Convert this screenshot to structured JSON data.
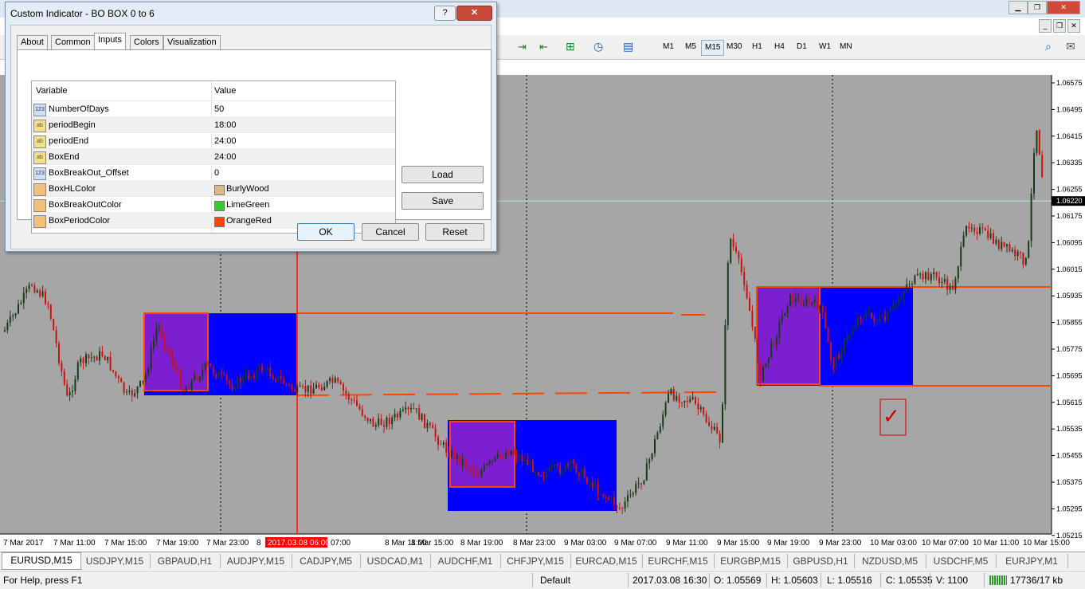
{
  "dialog": {
    "title": "Custom Indicator - BO BOX 0 to 6",
    "help_label": "?",
    "close_label": "✕",
    "tabs": [
      "About",
      "Common",
      "Inputs",
      "Colors",
      "Visualization"
    ],
    "selected_tab": "Inputs",
    "columns": {
      "variable": "Variable",
      "value": "Value"
    },
    "params": [
      {
        "type": "123",
        "name": "NumberOfDays",
        "value": "50"
      },
      {
        "type": "ab",
        "name": "periodBegin",
        "value": "18:00"
      },
      {
        "type": "ab",
        "name": "periodEnd",
        "value": "24:00"
      },
      {
        "type": "ab",
        "name": "BoxEnd",
        "value": "24:00"
      },
      {
        "type": "123",
        "name": "BoxBreakOut_Offset",
        "value": "0"
      },
      {
        "type": "color",
        "name": "BoxHLColor",
        "value": "BurlyWood",
        "color": "#deb887"
      },
      {
        "type": "color",
        "name": "BoxBreakOutColor",
        "value": "LimeGreen",
        "color": "#32cd32"
      },
      {
        "type": "color",
        "name": "BoxPeriodColor",
        "value": "OrangeRed",
        "color": "#ff4500"
      }
    ],
    "load_label": "Load",
    "save_label": "Save",
    "ok_label": "OK",
    "cancel_label": "Cancel",
    "reset_label": "Reset"
  },
  "toolbar": {
    "timeframes": [
      "M1",
      "M5",
      "M15",
      "M30",
      "H1",
      "H4",
      "D1",
      "W1",
      "MN"
    ],
    "selected_timeframe": "M15"
  },
  "chart": {
    "background": "#a6a6a6",
    "bull_color": "#1a3a1a",
    "bear_color": "#cc1010",
    "current_price_label": "1.06220",
    "price_ticks": [
      "1.06575",
      "1.06495",
      "1.06415",
      "1.06335",
      "1.06255",
      "1.06175",
      "1.06095",
      "1.06015",
      "1.05935",
      "1.05855",
      "1.05775",
      "1.05695",
      "1.05615",
      "1.05535",
      "1.05455",
      "1.05375",
      "1.05295",
      "1.05215"
    ],
    "time_labels": [
      "7 Mar 2017",
      "7 Mar 11:00",
      "7 Mar 15:00",
      "7 Mar 19:00",
      "7 Mar 23:00",
      "8",
      "07:00",
      "8 Mar 11:00",
      "8 Mar 15:00",
      "8 Mar 19:00",
      "8 Mar 23:00",
      "9 Mar 03:00",
      "9 Mar 07:00",
      "9 Mar 11:00",
      "9 Mar 15:00",
      "9 Mar 19:00",
      "9 Mar 23:00",
      "10 Mar 03:00",
      "10 Mar 07:00",
      "10 Mar 11:00",
      "10 Mar 15:00"
    ],
    "crosshair_time_label": "2017.03.08 06:00",
    "period_box_color": "#7b1fd0",
    "breakout_box_color": "#0000ff",
    "line_color": "#ff4500",
    "check_mark": "✓"
  },
  "symbol_tabs": [
    "EURUSD,M15",
    "USDJPY,M15",
    "GBPAUD,H1",
    "AUDJPY,M15",
    "CADJPY,M5",
    "USDCAD,M1",
    "AUDCHF,M1",
    "CHFJPY,M15",
    "EURCAD,M15",
    "EURCHF,M15",
    "EURGBP,M15",
    "GBPUSD,H1",
    "NZDUSD,M5",
    "USDCHF,M5",
    "EURJPY,M1"
  ],
  "selected_symbol_tab": "EURUSD,M15",
  "status": {
    "help": "For Help, press F1",
    "profile": "Default",
    "datetime": "2017.03.08 16:30",
    "open": "O: 1.05569",
    "high": "H: 1.05603",
    "low": "L: 1.05516",
    "close": "C: 1.05535",
    "volume": "V: 1100",
    "traffic": "17736/17 kb"
  }
}
